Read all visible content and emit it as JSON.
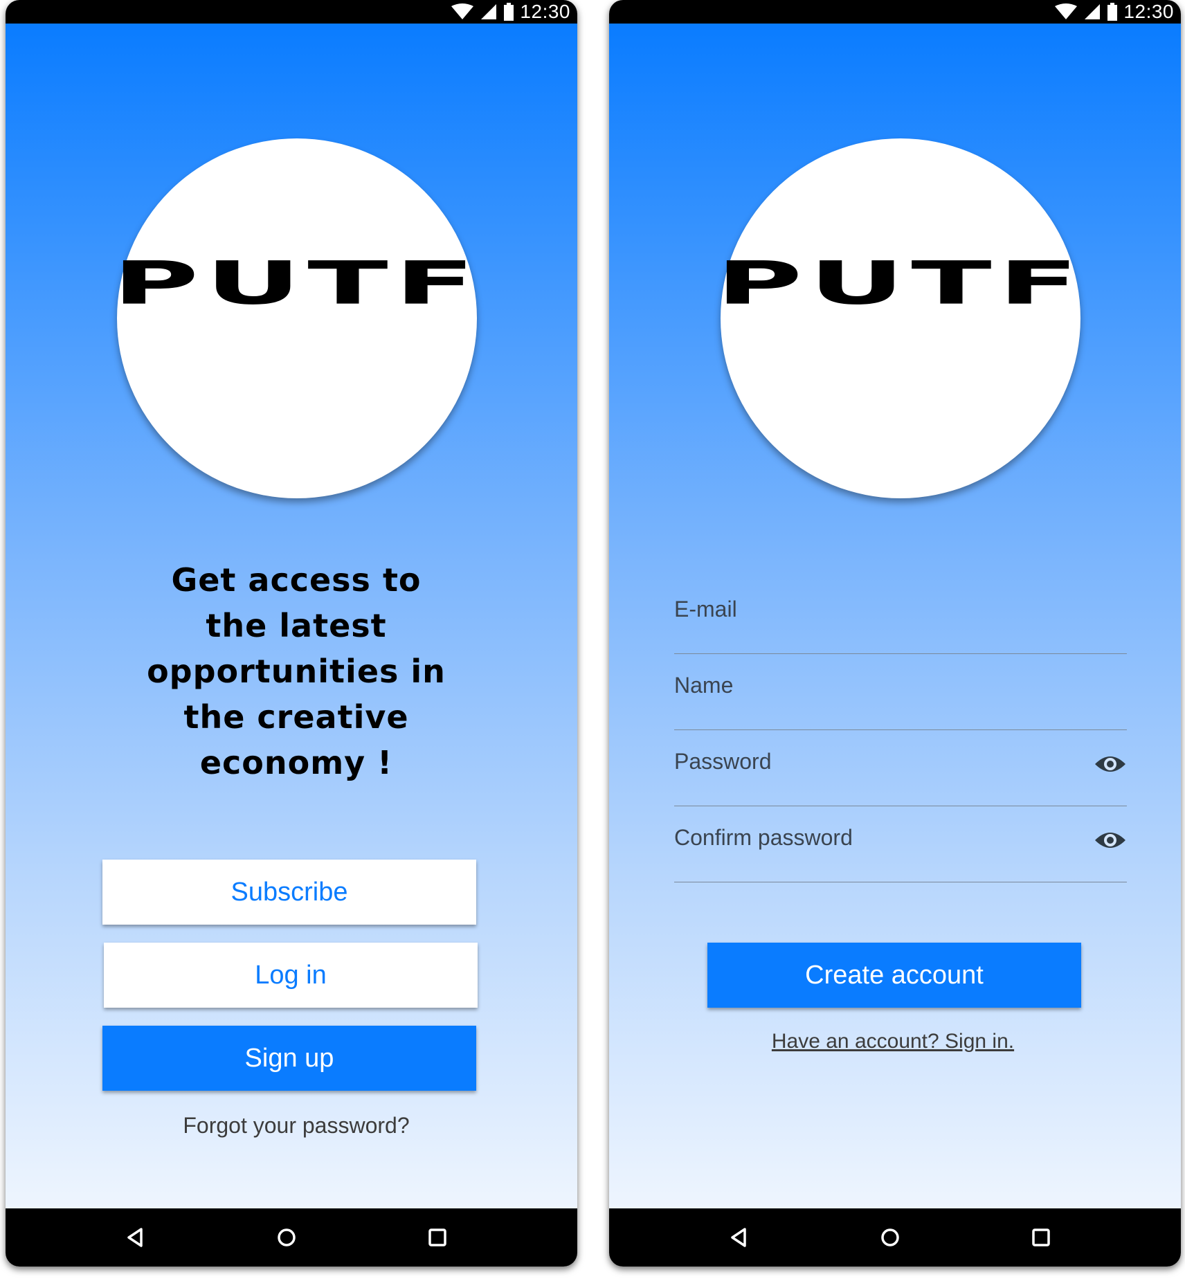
{
  "status_bar": {
    "time": "12:30"
  },
  "logo": {
    "text": "PUTF"
  },
  "welcome": {
    "headline_lines": [
      "Get access to",
      "the latest",
      "opportunities in",
      "the creative",
      "economy !"
    ],
    "subscribe_label": "Subscribe",
    "login_label": "Log in",
    "signup_label": "Sign up",
    "forgot_label": "Forgot your password?"
  },
  "signup_form": {
    "email_placeholder": "E-mail",
    "name_placeholder": "Name",
    "password_placeholder": "Password",
    "confirm_placeholder": "Confirm password",
    "create_label": "Create account",
    "signin_link": "Have an account? Sign in."
  },
  "colors": {
    "accent": "#0a7cff",
    "button_white": "#ffffff",
    "text_dark": "#3c3c3c"
  },
  "icons": {
    "status": [
      "wifi-icon",
      "signal-icon",
      "battery-icon"
    ],
    "nav": [
      "back-icon",
      "home-icon",
      "recents-icon"
    ],
    "field": "eye-icon"
  }
}
